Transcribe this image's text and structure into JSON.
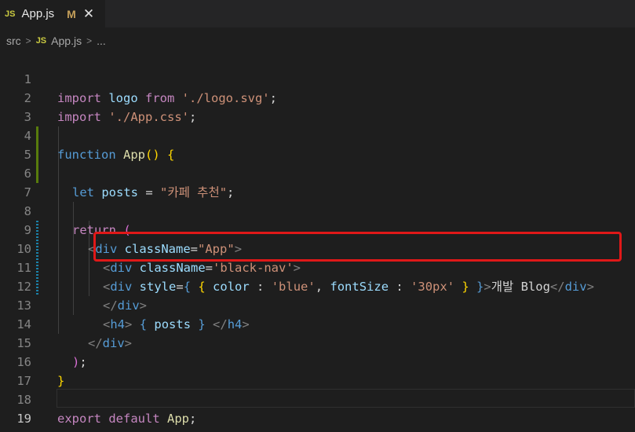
{
  "tab": {
    "badge": "JS",
    "filename": "App.js",
    "modified": "M",
    "close": "✕"
  },
  "breadcrumb": {
    "folder": "src",
    "badge": "JS",
    "file": "App.js",
    "rest": "..."
  },
  "code": {
    "line_numbers": [
      "1",
      "2",
      "3",
      "4",
      "5",
      "6",
      "7",
      "8",
      "9",
      "10",
      "11",
      "12",
      "13",
      "14",
      "15",
      "16",
      "17",
      "18",
      "19"
    ],
    "l1": {
      "import": "import",
      "name": " logo ",
      "from": "from",
      "path": " './logo.svg'",
      "semi": ";"
    },
    "l2": {
      "import": "import",
      "path": " './App.css'",
      "semi": ";"
    },
    "l4": {
      "function": "function",
      "name": " App",
      "paren": "()",
      "brace": " {"
    },
    "l6": {
      "let": "let",
      "var": " posts",
      "eq": " = ",
      "str": "\"카페 추천\"",
      "semi": ";"
    },
    "l8": {
      "return": "return",
      "paren": " ("
    },
    "l9": {
      "open": "<",
      "tag": "div",
      "attr": " className",
      "eq": "=",
      "val": "\"App\"",
      "close": ">"
    },
    "l10": {
      "open": "<",
      "tag": "div",
      "attr": " className",
      "eq": "=",
      "val": "'black-nav'",
      "close": ">"
    },
    "l11": {
      "open": "<",
      "tag": "div",
      "attr": " style",
      "eq": "=",
      "b1": "{",
      "b2": " {",
      "k1": " color",
      "c1": " : ",
      "v1": "'blue'",
      "comma": ", ",
      "k2": "fontSize",
      "c2": " : ",
      "v2": "'30px'",
      "b3": " }",
      "b4": " }",
      "gt": ">",
      "text": "개발 Blog",
      "end_open": "</",
      "end_tag": "div",
      "end_close": ">"
    },
    "l12": {
      "open": "</",
      "tag": "div",
      "close": ">"
    },
    "l13": {
      "open": "<",
      "tag": "h4",
      "close": ">",
      "b1": " {",
      "var": " posts",
      "b2": " }",
      "end_open": " </",
      "end_tag": "h4",
      "end_close": ">"
    },
    "l14": {
      "open": "</",
      "tag": "div",
      "close": ">"
    },
    "l15": {
      "paren": ")",
      "semi": ";"
    },
    "l16": {
      "brace": "}"
    },
    "l18": {
      "export": "export",
      "default": " default",
      "name": " App",
      "semi": ";"
    }
  }
}
